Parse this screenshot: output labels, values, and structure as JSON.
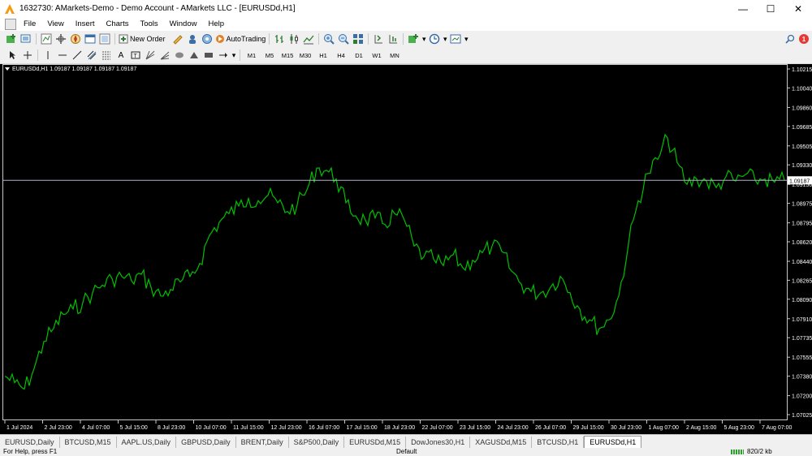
{
  "window": {
    "title": "1632730: AMarkets-Demo - Demo Account - AMarkets LLC - [EURUSDd,H1]",
    "controls": {
      "minimize": "—",
      "maximize": "☐",
      "close": "✕"
    }
  },
  "menu": [
    "File",
    "View",
    "Insert",
    "Charts",
    "Tools",
    "Window",
    "Help"
  ],
  "toolbar": {
    "new_order_label": "New Order",
    "autotrading_label": "AutoTrading",
    "notification_count": "1"
  },
  "timeframes": [
    "M1",
    "M5",
    "M15",
    "M30",
    "H1",
    "H4",
    "D1",
    "W1",
    "MN"
  ],
  "chart_data": {
    "type": "line",
    "symbol_label": "EURUSDd,H1  1.09187 1.09187 1.09187 1.09187",
    "current_price_label": "1.09187",
    "y_ticks": [
      "1.10215",
      "1.10040",
      "1.09860",
      "1.09685",
      "1.09505",
      "1.09330",
      "1.09150",
      "1.08975",
      "1.08795",
      "1.08620",
      "1.08440",
      "1.08265",
      "1.08090",
      "1.07910",
      "1.07735",
      "1.07555",
      "1.07380",
      "1.07200",
      "1.07025"
    ],
    "x_ticks": [
      "1 Jul 2024",
      "2 Jul 23:00",
      "4 Jul 07:00",
      "5 Jul 15:00",
      "8 Jul 23:00",
      "10 Jul 07:00",
      "11 Jul 15:00",
      "12 Jul 23:00",
      "16 Jul 07:00",
      "17 Jul 15:00",
      "18 Jul 23:00",
      "22 Jul 07:00",
      "23 Jul 15:00",
      "24 Jul 23:00",
      "26 Jul 07:00",
      "29 Jul 15:00",
      "30 Jul 23:00",
      "1 Aug 07:00",
      "2 Aug 15:00",
      "5 Aug 23:00",
      "7 Aug 07:00"
    ],
    "x": [
      0,
      4,
      8,
      12,
      16,
      20,
      24,
      28,
      32,
      36,
      40,
      44,
      48,
      52,
      56,
      60,
      64,
      68,
      72,
      76,
      80,
      84,
      88,
      92,
      96,
      100,
      104,
      108,
      112,
      116,
      120,
      124,
      128,
      132,
      136,
      140,
      144,
      148,
      152,
      156,
      160,
      164,
      168,
      172,
      176,
      180,
      184,
      188,
      192,
      196,
      200,
      204,
      208,
      212,
      216,
      220,
      224,
      228,
      232,
      236,
      240,
      244,
      248,
      252,
      256,
      260,
      264,
      268,
      272,
      276,
      280,
      284,
      288,
      292,
      296,
      300,
      304,
      308,
      312,
      316,
      320
    ],
    "series": [
      {
        "values": [
          1.0738,
          1.0732,
          1.0726,
          1.0745,
          1.077,
          1.0782,
          1.0795,
          1.08,
          1.0806,
          1.0815,
          1.0822,
          1.0828,
          1.083,
          1.0826,
          1.0832,
          1.082,
          1.0812,
          1.0818,
          1.0825,
          1.083,
          1.0842,
          1.0868,
          1.088,
          1.0888,
          1.0895,
          1.0902,
          1.09,
          1.0905,
          1.0898,
          1.089,
          1.0896,
          1.091,
          1.093,
          1.0928,
          1.092,
          1.0898,
          1.0886,
          1.0882,
          1.0884,
          1.0878,
          1.0888,
          1.0882,
          1.0858,
          1.0848,
          1.0846,
          1.084,
          1.085,
          1.0838,
          1.0845,
          1.0852,
          1.0858,
          1.0853,
          1.0835,
          1.0823,
          1.0816,
          1.0815,
          1.082,
          1.083,
          1.0815,
          1.08,
          1.079,
          1.0782,
          1.079,
          1.0812,
          1.086,
          1.09,
          1.0925,
          1.0938,
          1.0958,
          1.0935,
          1.0915,
          1.092,
          1.0918,
          1.0912,
          1.0922,
          1.0918,
          1.0924,
          1.0919,
          1.092,
          1.0917,
          1.0919
        ]
      }
    ],
    "ylim": [
      1.07025,
      1.10215
    ],
    "colors": {
      "line": "#00c000",
      "background": "#000000",
      "axis": "#c8c8c8",
      "current_price_line": "#b0b0c8"
    }
  },
  "tabs": [
    "EURUSD,Daily",
    "BTCUSD,M15",
    "AAPL.US,Daily",
    "GBPUSD,Daily",
    "BRENT,Daily",
    "S&P500,Daily",
    "EURUSDd,M15",
    "DowJones30,H1",
    "XAGUSDd,M15",
    "BTCUSD,H1",
    "EURUSDd,H1"
  ],
  "status": {
    "left": "For Help, press F1",
    "middle": "Default",
    "right": "820/2 kb"
  }
}
